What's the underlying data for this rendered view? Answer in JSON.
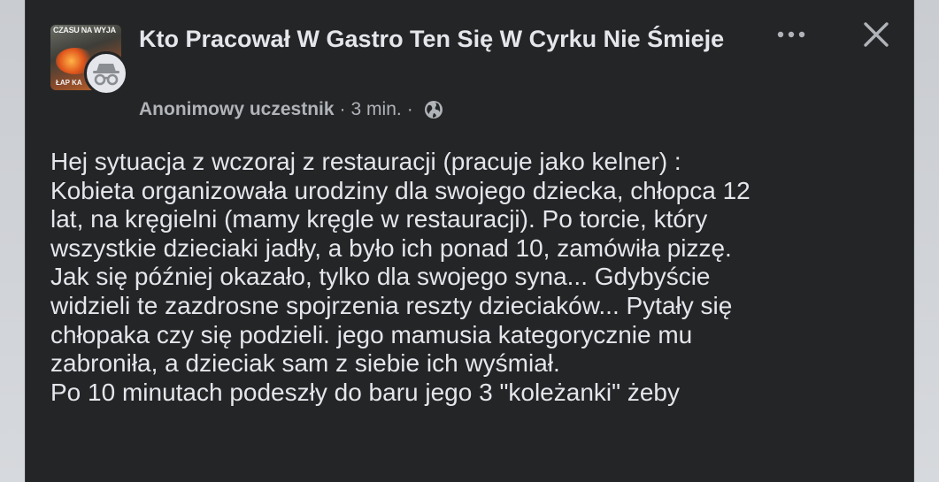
{
  "post": {
    "group_thumbnail": {
      "top_text": "CZASU NA WYJA",
      "bottom_text": "ŁAP KA"
    },
    "avatar_icon": "incognito-icon",
    "group_name": "Kto Pracował W Gastro Ten Się W Cyrku Nie Śmieje",
    "author": "Anonimowy uczestnik",
    "separator": "·",
    "time": "3 min.",
    "privacy_icon": "globe-icon",
    "more_icon": "more-options-icon",
    "close_icon": "close-icon",
    "body_lines": [
      "Hej sytuacja z wczoraj z restauracji (pracuje jako kelner) :",
      "Kobieta organizowała urodziny dla swojego dziecka, chłopca 12",
      "lat, na kręgielni (mamy kręgle w restauracji). Po torcie, który",
      "wszystkie dzieciaki jadły, a było ich ponad 10, zamówiła pizzę.",
      "Jak się później okazało, tylko dla swojego syna... Gdybyście",
      "widzieli te zazdrosne spojrzenia reszty dzieciaków... Pytały się",
      "chłopaka czy się podzieli. jego mamusia kategorycznie mu",
      "zabroniła, a dzieciak sam z siebie ich wyśmiał.",
      "Po 10 minutach podeszły do baru jego 3 \"koleżanki\" żeby"
    ]
  },
  "colors": {
    "card_background": "#242526",
    "primary_text": "#e4e6eb",
    "secondary_text": "#b0b3b8",
    "page_background": "#cfd2d6"
  }
}
